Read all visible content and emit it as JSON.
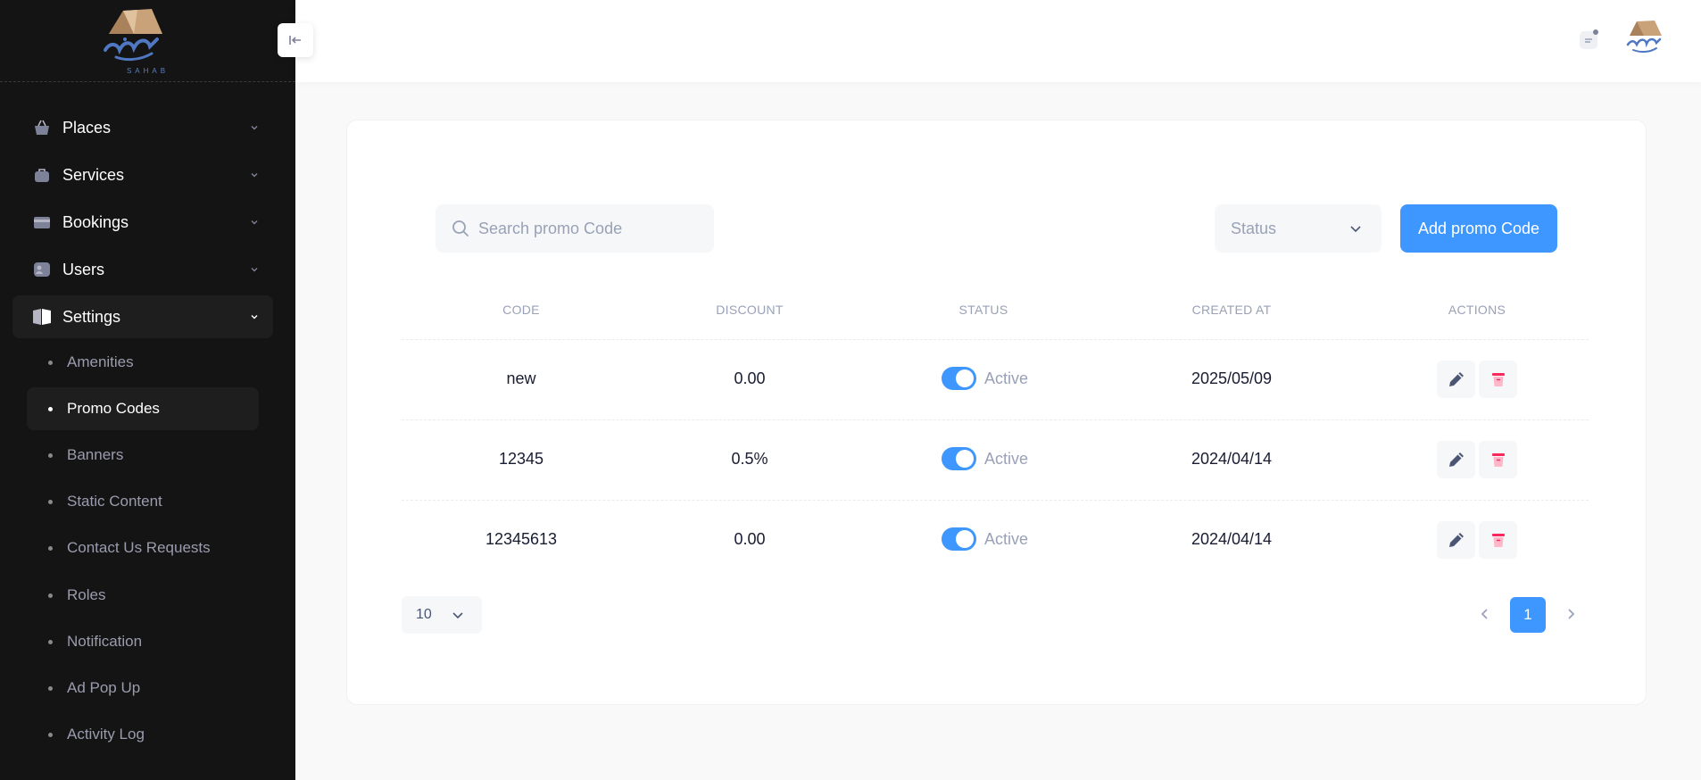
{
  "brand": {
    "sub": "SAHAB"
  },
  "sidebar": {
    "items": [
      {
        "label": "Places",
        "icon": "basket-icon"
      },
      {
        "label": "Services",
        "icon": "bag-icon"
      },
      {
        "label": "Bookings",
        "icon": "wallet-icon"
      },
      {
        "label": "Users",
        "icon": "user-card-icon"
      },
      {
        "label": "Settings",
        "icon": "book-icon"
      }
    ],
    "settings_sub": [
      {
        "label": "Amenities"
      },
      {
        "label": "Promo Codes"
      },
      {
        "label": "Banners"
      },
      {
        "label": "Static Content"
      },
      {
        "label": "Contact Us Requests"
      },
      {
        "label": "Roles"
      },
      {
        "label": "Notification"
      },
      {
        "label": "Ad Pop Up"
      },
      {
        "label": "Activity Log"
      }
    ]
  },
  "toolbar": {
    "search_placeholder": "Search promo Code",
    "status_label": "Status",
    "add_label": "Add promo Code"
  },
  "table": {
    "headers": {
      "code": "CODE",
      "discount": "DISCOUNT",
      "status": "STATUS",
      "created": "CREATED AT",
      "actions": "ACTIONS"
    },
    "rows": [
      {
        "code": "new",
        "discount": "0.00",
        "status": "Active",
        "created": "2025/05/09"
      },
      {
        "code": "12345",
        "discount": "0.5%",
        "status": "Active",
        "created": "2024/04/14"
      },
      {
        "code": "12345613",
        "discount": "0.00",
        "status": "Active",
        "created": "2024/04/14"
      }
    ]
  },
  "pagination": {
    "page_size": "10",
    "current_page": "1"
  },
  "colors": {
    "accent": "#3e97ff",
    "sidebar_bg": "#141414",
    "danger": "#f8285a"
  }
}
